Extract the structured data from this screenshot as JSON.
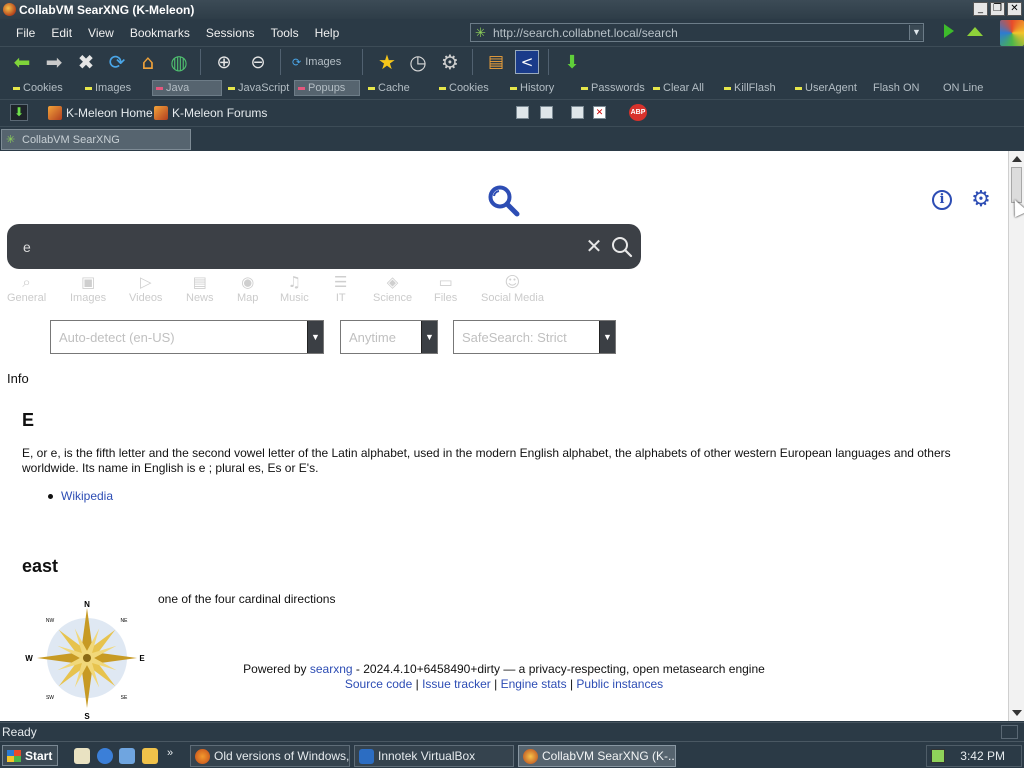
{
  "window": {
    "title": "CollabVM SearXNG (K-Meleon)"
  },
  "menu": [
    "File",
    "Edit",
    "View",
    "Bookmarks",
    "Sessions",
    "Tools",
    "Help"
  ],
  "urlbar": {
    "url": "http://search.collabnet.local/search"
  },
  "toolbar": {
    "images_toggle": "Images"
  },
  "prefs": [
    "Cookies",
    "Images",
    "Java",
    "JavaScript",
    "Popups",
    "Cache",
    "Cookies",
    "History",
    "Passwords",
    "Clear All",
    "KillFlash",
    "UserAgent",
    "Flash ON",
    "ON Line"
  ],
  "bookmarks": [
    "K-Meleon Home",
    "K-Meleon Forums"
  ],
  "tabs": [
    {
      "label": "CollabVM SearXNG"
    }
  ],
  "search": {
    "query": "e",
    "clear_symbol": "✕"
  },
  "categories": [
    "General",
    "Images",
    "Videos",
    "News",
    "Map",
    "Music",
    "IT",
    "Science",
    "Files",
    "Social Media"
  ],
  "filters": {
    "language": "Auto-detect (en-US)",
    "time": "Anytime",
    "safesearch": "SafeSearch: Strict"
  },
  "infobox": {
    "label": "Info"
  },
  "results": [
    {
      "title": "E",
      "description": "E, or e, is the fifth letter and the second vowel letter of the Latin alphabet, used in the modern English alphabet, the alphabets of other western European languages and others worldwide. Its name in English is e ; plural es, Es or E's.",
      "link": "Wikipedia"
    },
    {
      "title": "east",
      "description": "one of the four cardinal directions"
    }
  ],
  "compass_labels": {
    "n": "N",
    "s": "S",
    "e": "E",
    "w": "W",
    "ne": "NE",
    "nw": "NW",
    "se": "SE",
    "sw": "SW"
  },
  "footer": {
    "powered_prefix": "Powered by ",
    "searxng": "searxng",
    "powered_suffix": " - 2024.4.10+6458490+dirty — a privacy-respecting, open metasearch engine",
    "links": [
      "Source code",
      "Issue tracker",
      "Engine stats",
      "Public instances"
    ],
    "separator": " | "
  },
  "status": {
    "text": "Ready"
  },
  "taskbar": {
    "start": "Start",
    "tasks": [
      "Old versions of Windows,...",
      "Innotek VirtualBox",
      "CollabVM SearXNG (K-..."
    ],
    "clock": "3:42 PM"
  },
  "colors": {
    "chrome": "#2b3a46",
    "link": "#2d4db4",
    "searchbox": "#3c4046"
  }
}
